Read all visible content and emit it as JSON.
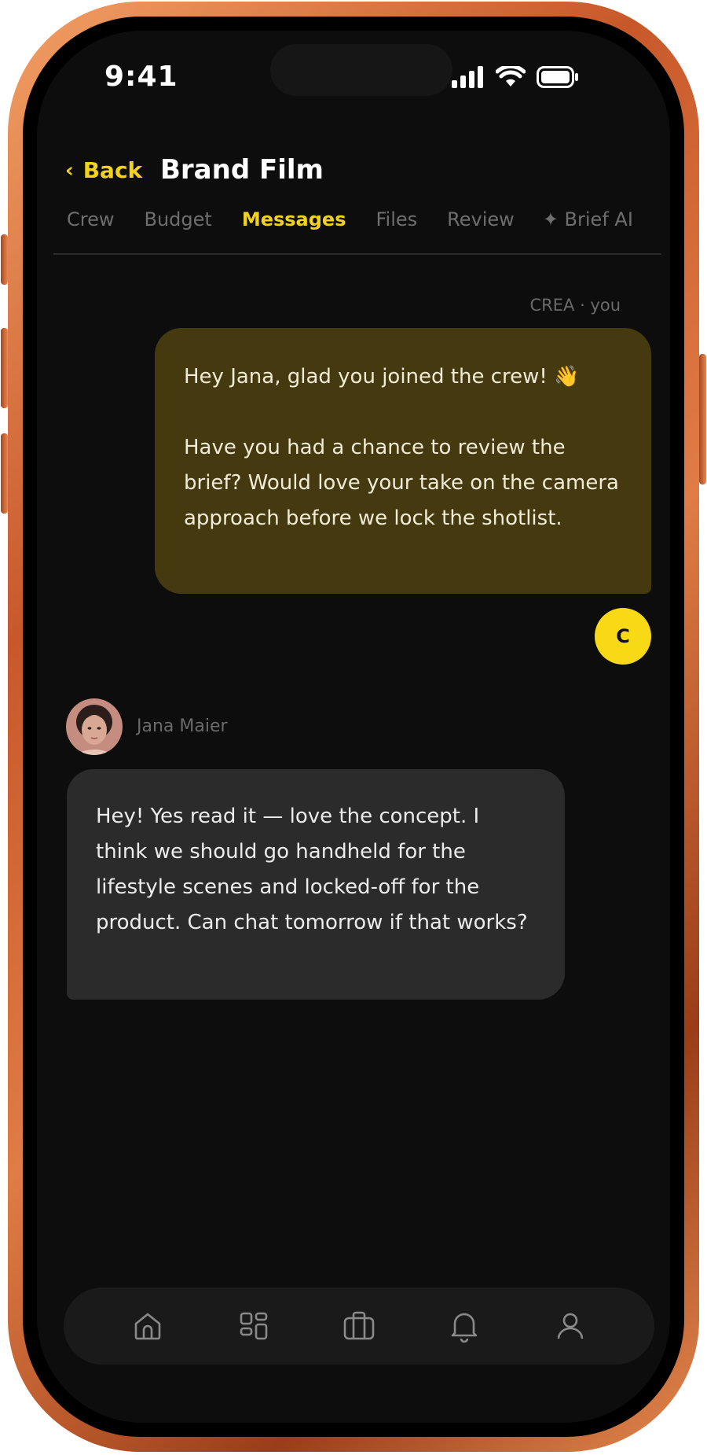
{
  "status": {
    "time": "9:41"
  },
  "header": {
    "back_label": "Back",
    "title": "Brand Film"
  },
  "tabs": [
    {
      "label": "Crew",
      "active": false
    },
    {
      "label": "Budget",
      "active": false
    },
    {
      "label": "Messages",
      "active": true
    },
    {
      "label": "Files",
      "active": false
    },
    {
      "label": "Review",
      "active": false
    },
    {
      "label": "✦ Brief AI",
      "active": false
    }
  ],
  "messages": {
    "outgoing": {
      "meta": "CREA · you",
      "paragraph_1": "Hey Jana, glad you joined the crew! 👋",
      "paragraph_2": "Have you had a chance to review the brief? Would love your take on the camera approach before we lock the shotlist.",
      "avatar_initial": "C"
    },
    "incoming": {
      "sender": "Jana Maier",
      "text": "Hey! Yes read it — love the concept. I think we should go handheld for the lifestyle scenes and locked-off for the product. Can chat tomorrow if that works?"
    }
  },
  "bottom_nav": {
    "icons": [
      "home-icon",
      "grid-icon",
      "briefcase-icon",
      "bell-icon",
      "profile-icon"
    ]
  },
  "colors": {
    "accent": "#f2d21c",
    "outgoing_bubble": "#45390f",
    "incoming_bubble": "#2b2b2b",
    "screen_bg": "#0d0d0d",
    "frame": "#d86a35"
  }
}
